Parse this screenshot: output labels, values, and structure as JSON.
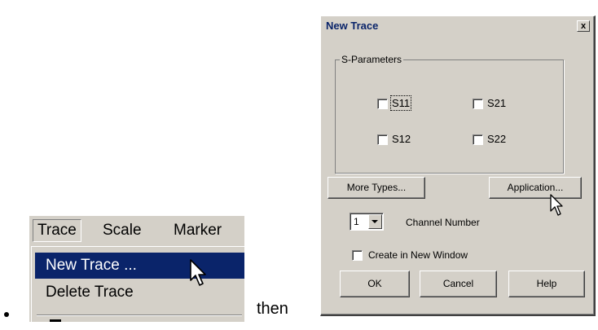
{
  "menu": {
    "bar_items": [
      "Trace",
      "Scale",
      "Marker"
    ],
    "dropdown_items": [
      {
        "label": "New Trace ...",
        "highlighted": true
      },
      {
        "label": "Delete Trace",
        "highlighted": false
      }
    ],
    "highlight_color": "#0a246a"
  },
  "connector_text": "then",
  "dialog": {
    "title": "New Trace",
    "close_glyph": "x",
    "group_label": "S-Parameters",
    "checkboxes": [
      {
        "label": "S11",
        "checked": false,
        "focused": true
      },
      {
        "label": "S21",
        "checked": false
      },
      {
        "label": "S12",
        "checked": false
      },
      {
        "label": "S22",
        "checked": false
      }
    ],
    "buttons": {
      "more_types": "More Types...",
      "application": "Application...",
      "ok": "OK",
      "cancel": "Cancel",
      "help": "Help"
    },
    "channel": {
      "value": "1",
      "label": "Channel Number"
    },
    "new_window": {
      "label": "Create in New Window",
      "checked": false
    }
  }
}
